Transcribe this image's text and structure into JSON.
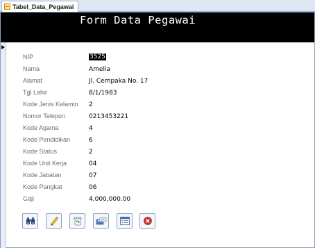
{
  "tab": {
    "label": "Tabel_Data_Pegawai"
  },
  "form": {
    "title": "Form Data Pegawai"
  },
  "fields": [
    {
      "label": "NIP",
      "value": "3525"
    },
    {
      "label": "Nama",
      "value": "Amelia"
    },
    {
      "label": "Alamat",
      "value": "Jl. Cempaka No. 17"
    },
    {
      "label": "Tgl Lahir",
      "value": "8/1/1983"
    },
    {
      "label": "Kode Jenis Kelamin",
      "value": "2"
    },
    {
      "label": "Nomor Telepon",
      "value": "0213453221"
    },
    {
      "label": "Kode Agama",
      "value": "4"
    },
    {
      "label": "Kode Pendidikan",
      "value": "6"
    },
    {
      "label": "Kode Status",
      "value": "2"
    },
    {
      "label": "Kode Unit Kerja",
      "value": "04"
    },
    {
      "label": "Kode Jabatan",
      "value": "07"
    },
    {
      "label": "Kode Pangkat",
      "value": "06"
    },
    {
      "label": "Gaji",
      "value": "4,000,000.00"
    }
  ],
  "buttons": [
    {
      "icon": "binoculars-icon"
    },
    {
      "icon": "pencil-icon"
    },
    {
      "icon": "recycle-icon"
    },
    {
      "icon": "save-record-icon"
    },
    {
      "icon": "form-icon"
    },
    {
      "icon": "close-icon"
    }
  ],
  "colors": {
    "header_bg": "#000000",
    "header_text": "#ffffff",
    "label_text": "#6d6d6d",
    "close_red": "#d0312d"
  }
}
